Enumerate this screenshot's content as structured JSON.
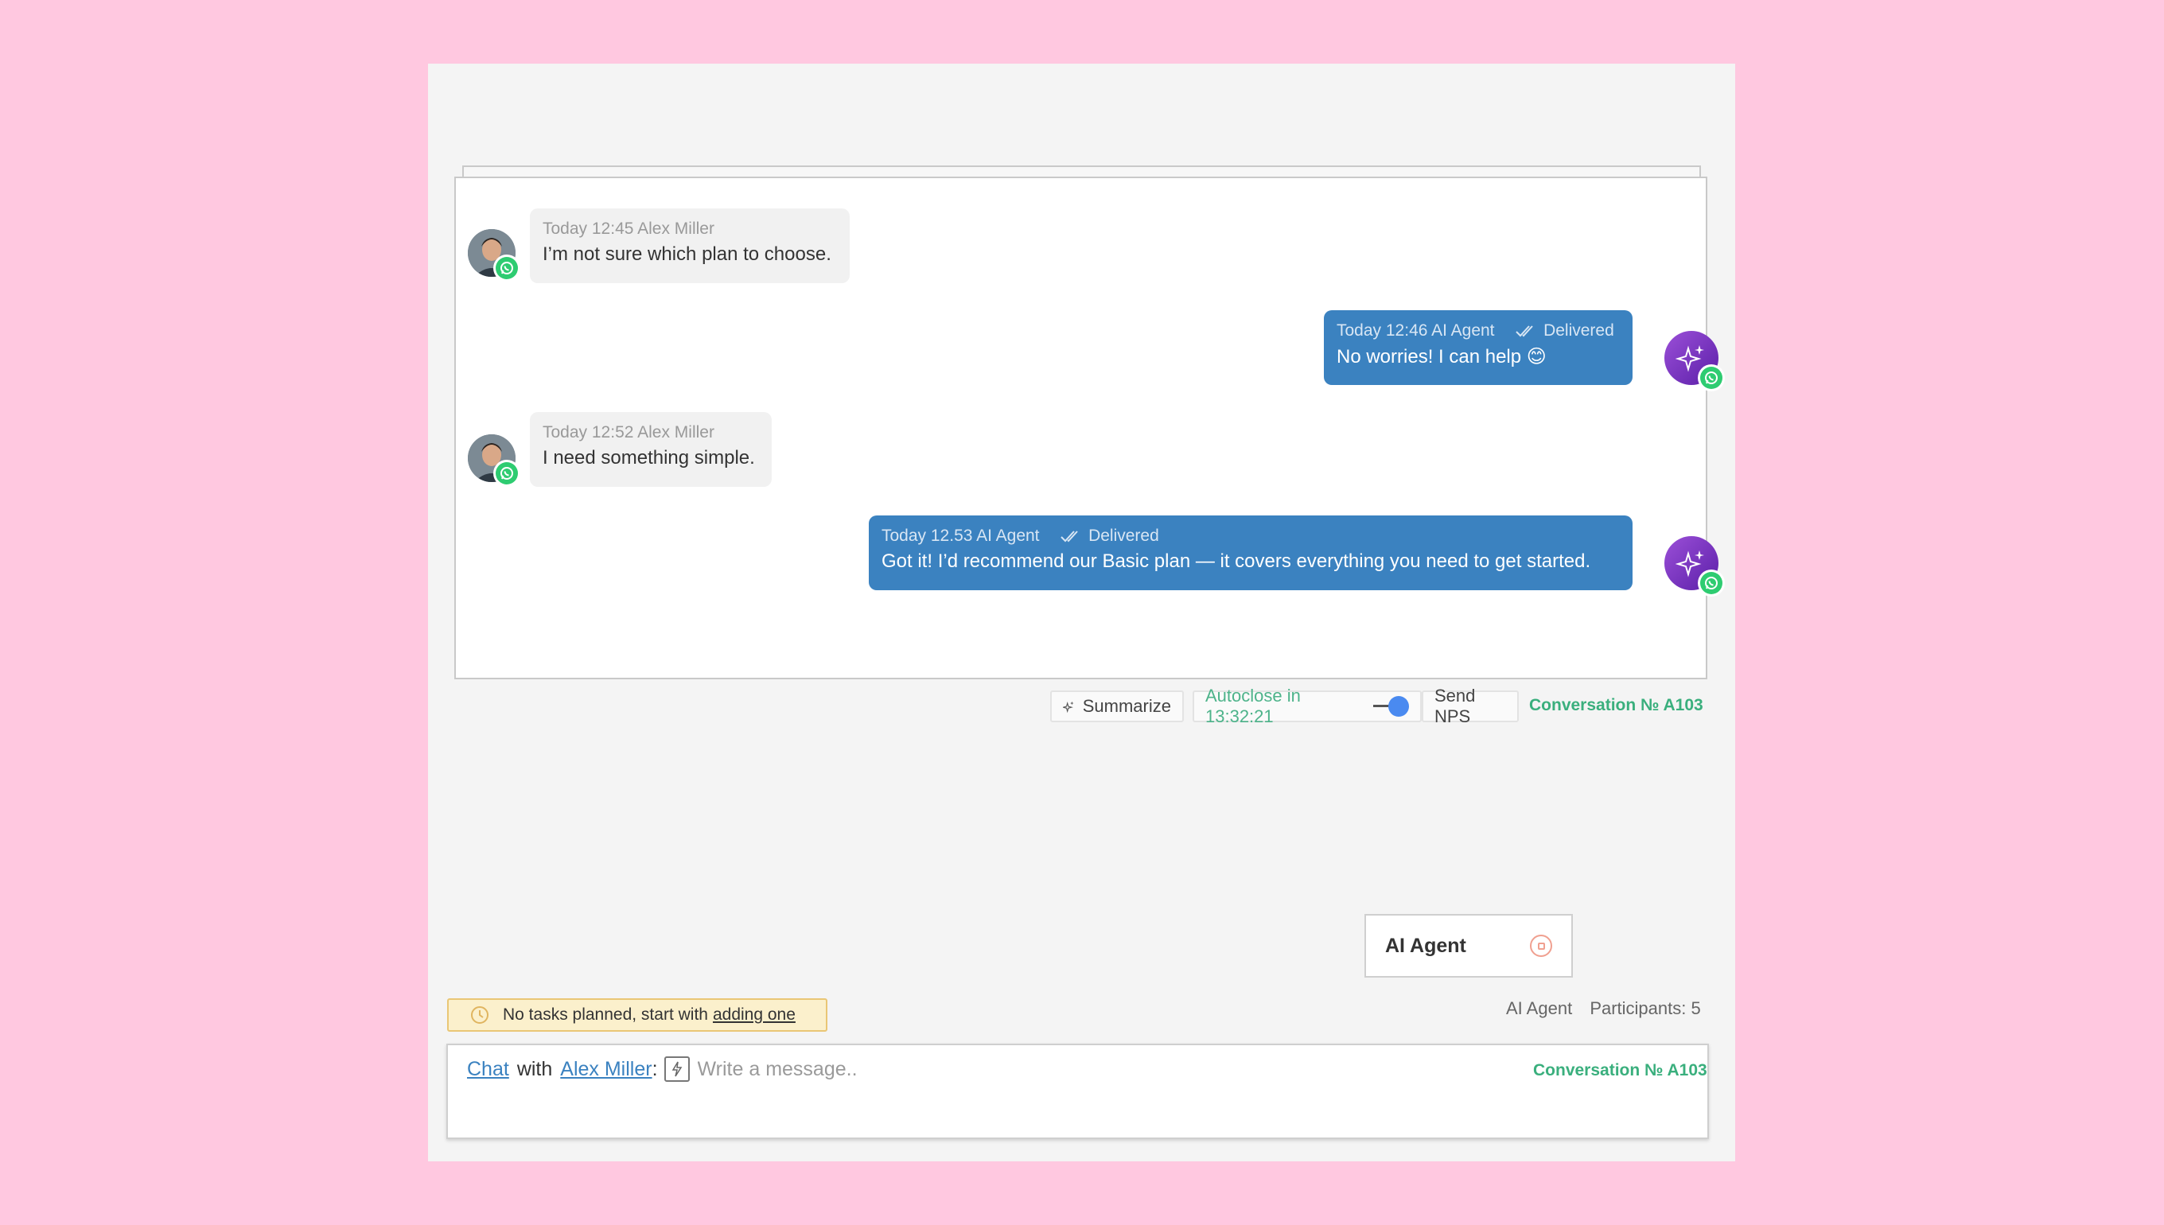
{
  "colors": {
    "page_background": "#ffc8e0",
    "outgoing_bubble": "#3b82c0",
    "incoming_bubble": "#f1f1f1",
    "conversation_link": "#3aaf7d",
    "whatsapp_green": "#2ecc71",
    "agent_avatar": "#7a35c4"
  },
  "messages": [
    {
      "direction": "in",
      "time": "Today 12:45",
      "author": "Alex Miller",
      "text": "I’m not sure which plan to choose.",
      "channel_icon": "whatsapp-icon"
    },
    {
      "direction": "out",
      "time": "Today 12:46",
      "author": "AI Agent",
      "status": "Delivered",
      "text": "No worries! I can help 😊",
      "channel_icon": "whatsapp-icon"
    },
    {
      "direction": "in",
      "time": "Today 12:52",
      "author": "Alex Miller",
      "text": "I need something simple.",
      "channel_icon": "whatsapp-icon"
    },
    {
      "direction": "out",
      "time": "Today 12.53",
      "author": "AI Agent",
      "status": "Delivered",
      "text": "Got it! I’d recommend our Basic plan — it covers everything you need to get started.",
      "channel_icon": "whatsapp-icon"
    }
  ],
  "toolbar": {
    "summarize_label": "Summarize",
    "autoclose_label": "Autoclose in 13:32:21",
    "send_nps_label": "Send NPS",
    "conversation_label": "Conversation № A103"
  },
  "agent_card": {
    "label": "AI Agent"
  },
  "tasks": {
    "text": "No tasks planned, start with",
    "link": "adding one"
  },
  "participants": {
    "agent": "AI Agent",
    "count_label": "Participants: 5"
  },
  "composer": {
    "chat_link": "Chat",
    "with_text": "with",
    "contact_link": "Alex Miller",
    "colon": ":",
    "placeholder": "Write a message..",
    "conversation_label": "Conversation № A103"
  }
}
